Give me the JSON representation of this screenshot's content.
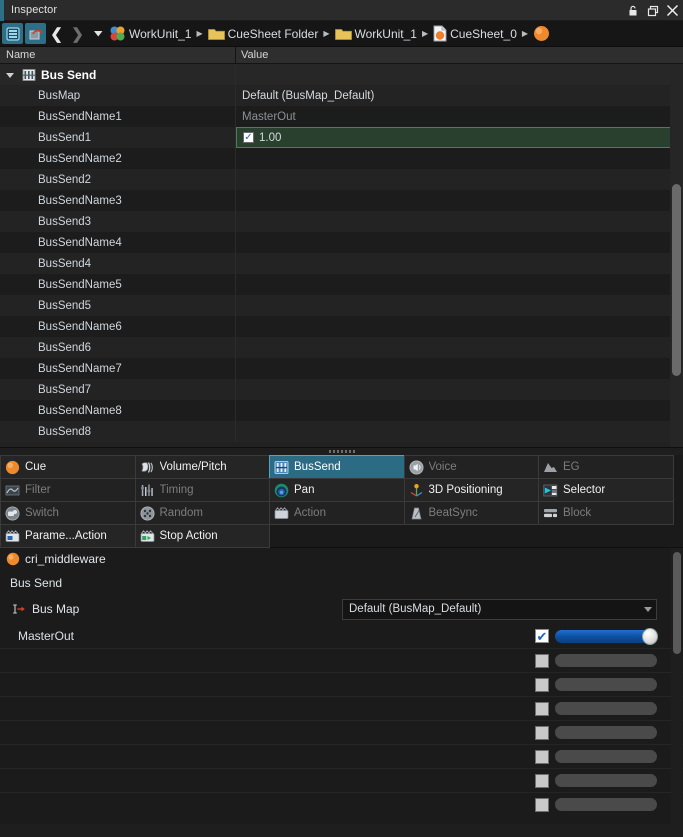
{
  "window": {
    "title": "Inspector",
    "controls": [
      {
        "name": "lock-icon",
        "glyph": "⚿"
      },
      {
        "name": "restore-icon",
        "glyph": "❐"
      },
      {
        "name": "close-icon",
        "glyph": "✕"
      }
    ]
  },
  "toolbar": {
    "list_view_button": "list-view",
    "revert_button": "revert",
    "back_label": "❮",
    "forward_label": "❯",
    "history_label": "▼"
  },
  "breadcrumb": [
    {
      "label": "WorkUnit_1",
      "icon": "workunit-spheres-icon"
    },
    {
      "label": "CueSheet Folder",
      "icon": "folder-icon"
    },
    {
      "label": "WorkUnit_1",
      "icon": "folder-icon"
    },
    {
      "label": "CueSheet_0",
      "icon": "cuesheet-file-icon"
    },
    {
      "label": "",
      "icon": "cue-sphere-icon"
    }
  ],
  "property_grid": {
    "columns": [
      "Name",
      "Value"
    ],
    "group": {
      "label": "Bus Send",
      "icon": "bus-send-icon",
      "expanded": true
    },
    "rows": [
      {
        "name": "BusMap",
        "value": "Default (BusMap_Default)",
        "style": "normal"
      },
      {
        "name": "BusSendName1",
        "value": "MasterOut",
        "style": "dim"
      },
      {
        "name": "BusSend1",
        "value": "1.00",
        "style": "highlight",
        "checked": true
      },
      {
        "name": "BusSendName2",
        "value": "",
        "style": "normal"
      },
      {
        "name": "BusSend2",
        "value": "",
        "style": "normal"
      },
      {
        "name": "BusSendName3",
        "value": "",
        "style": "normal"
      },
      {
        "name": "BusSend3",
        "value": "",
        "style": "normal"
      },
      {
        "name": "BusSendName4",
        "value": "",
        "style": "normal"
      },
      {
        "name": "BusSend4",
        "value": "",
        "style": "normal"
      },
      {
        "name": "BusSendName5",
        "value": "",
        "style": "normal"
      },
      {
        "name": "BusSend5",
        "value": "",
        "style": "normal"
      },
      {
        "name": "BusSendName6",
        "value": "",
        "style": "normal"
      },
      {
        "name": "BusSend6",
        "value": "",
        "style": "normal"
      },
      {
        "name": "BusSendName7",
        "value": "",
        "style": "normal"
      },
      {
        "name": "BusSend7",
        "value": "",
        "style": "normal"
      },
      {
        "name": "BusSendName8",
        "value": "",
        "style": "normal"
      },
      {
        "name": "BusSend8",
        "value": "",
        "style": "normal"
      }
    ]
  },
  "tabs": [
    {
      "label": "Cue",
      "icon": "cue-sphere-icon",
      "state": "enabled"
    },
    {
      "label": "Volume/Pitch",
      "icon": "volume-pitch-icon",
      "state": "enabled"
    },
    {
      "label": "BusSend",
      "icon": "bus-send-icon",
      "state": "active"
    },
    {
      "label": "Voice",
      "icon": "voice-icon",
      "state": "disabled"
    },
    {
      "label": "EG",
      "icon": "eg-envelope-icon",
      "state": "disabled"
    },
    {
      "label": "Filter",
      "icon": "filter-icon",
      "state": "disabled"
    },
    {
      "label": "Timing",
      "icon": "timing-icon",
      "state": "disabled"
    },
    {
      "label": "Pan",
      "icon": "pan-icon",
      "state": "enabled"
    },
    {
      "label": "3D Positioning",
      "icon": "positioning-3d-icon",
      "state": "enabled"
    },
    {
      "label": "Selector",
      "icon": "selector-icon",
      "state": "enabled"
    },
    {
      "label": "Switch",
      "icon": "switch-icon",
      "state": "disabled"
    },
    {
      "label": "Random",
      "icon": "random-icon",
      "state": "disabled"
    },
    {
      "label": "Action",
      "icon": "action-icon",
      "state": "disabled"
    },
    {
      "label": "BeatSync",
      "icon": "beatsync-metronome-icon",
      "state": "disabled"
    },
    {
      "label": "Block",
      "icon": "block-icon",
      "state": "disabled"
    },
    {
      "label": "Parame...Action",
      "icon": "parameter-action-icon",
      "state": "enabled"
    },
    {
      "label": "Stop Action",
      "icon": "stop-action-icon",
      "state": "enabled"
    },
    {
      "label": "",
      "icon": "",
      "state": "empty"
    },
    {
      "label": "",
      "icon": "",
      "state": "empty"
    },
    {
      "label": "",
      "icon": "",
      "state": "empty"
    }
  ],
  "detail": {
    "object_title": "cri_middleware",
    "object_icon": "cue-sphere-icon",
    "section_label": "Bus Send",
    "bus_map": {
      "label": "Bus Map",
      "link_icon": "link-arrow-icon",
      "selected": "Default (BusMap_Default)"
    },
    "sends": [
      {
        "name": "MasterOut",
        "checked": true,
        "level": 100
      },
      {
        "name": "",
        "checked": false,
        "level": 0
      },
      {
        "name": "",
        "checked": false,
        "level": 0
      },
      {
        "name": "",
        "checked": false,
        "level": 0
      },
      {
        "name": "",
        "checked": false,
        "level": 0
      },
      {
        "name": "",
        "checked": false,
        "level": 0
      },
      {
        "name": "",
        "checked": false,
        "level": 0
      },
      {
        "name": "",
        "checked": false,
        "level": 0
      }
    ]
  },
  "colors": {
    "accent": "#2d6f86",
    "highlight_row": "#29402f",
    "slider_active": "#1f6fd0",
    "title_accent": "#2d6f86"
  }
}
